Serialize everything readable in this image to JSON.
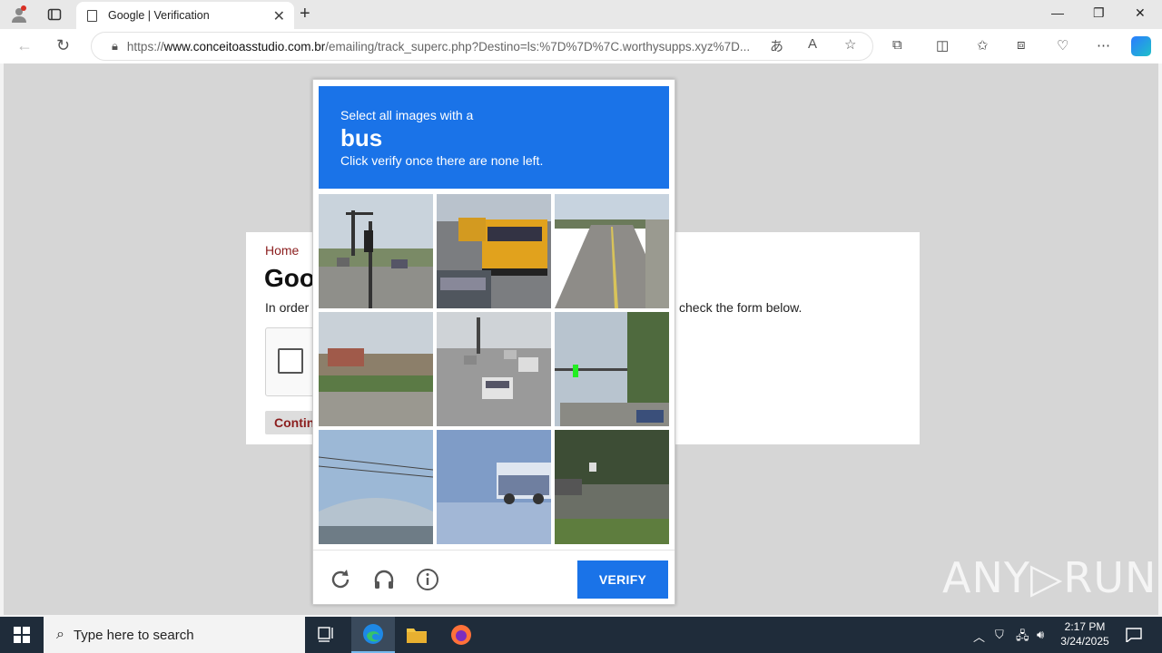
{
  "browser": {
    "tab_title": "Google | Verification",
    "new_tab": "+",
    "url_prefix": "https://",
    "url_domain": "www.conceitoasstudio.com.br",
    "url_path": "/emailing/track_superc.php?Destino=ls:%7D%7D%7C.worthysupps.xyz%7D...",
    "minimize": "—",
    "maximize": "❐",
    "close": "✕"
  },
  "page": {
    "breadcrumb": "Home",
    "title": "Goo",
    "intro_left": "In order",
    "intro_right": "check the form below.",
    "continue_label": "Contin"
  },
  "captcha": {
    "instruction": "Select all images with a",
    "target": "bus",
    "hint": "Click verify once there are none left.",
    "tiles": [
      "traffic-lights-intersection",
      "school-bus-street",
      "empty-road",
      "landscaped-median",
      "highway-traffic",
      "traffic-light-trees",
      "power-lines-building",
      "truck-road",
      "roadside-grass"
    ],
    "verify_label": "VERIFY"
  },
  "watermark": "ANY▷RUN",
  "taskbar": {
    "search_placeholder": "Type here to search",
    "time": "2:17 PM",
    "date": "3/24/2025"
  },
  "colors": {
    "captcha_blue": "#1a73e8",
    "link_red": "#8b1d1d"
  }
}
